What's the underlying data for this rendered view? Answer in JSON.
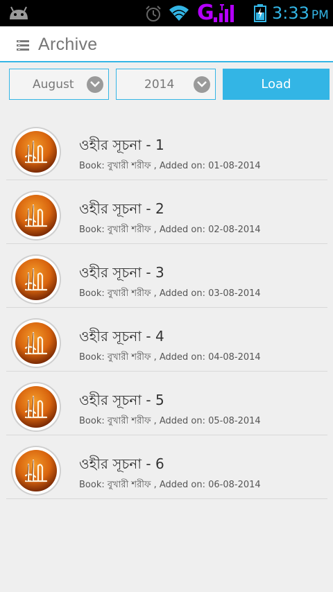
{
  "status_bar": {
    "time": "3:33",
    "ampm": "PM",
    "network": "G",
    "icons": [
      "android-icon",
      "alarm-icon",
      "wifi-icon",
      "signal-icon",
      "battery-icon"
    ],
    "accent_color": "#33b5e5",
    "network_color": "#b400ff"
  },
  "action_bar": {
    "title": "Archive"
  },
  "filters": {
    "month": "August",
    "year": "2014",
    "load_label": "Load"
  },
  "items": [
    {
      "title": "ওহীর সূচনা - 1",
      "meta": "Book: বুখারী শরীফ , Added on: 01-08-2014"
    },
    {
      "title": "ওহীর সূচনা - 2",
      "meta": "Book: বুখারী শরীফ , Added on: 02-08-2014"
    },
    {
      "title": "ওহীর সূচনা - 3",
      "meta": "Book: বুখারী শরীফ , Added on: 03-08-2014"
    },
    {
      "title": "ওহীর সূচনা - 4",
      "meta": "Book: বুখারী শরীফ , Added on: 04-08-2014"
    },
    {
      "title": "ওহীর সূচনা - 5",
      "meta": "Book: বুখারী শরীফ , Added on: 05-08-2014"
    },
    {
      "title": "ওহীর সূচনা - 6",
      "meta": "Book: বুখারী শরীফ , Added on: 06-08-2014"
    }
  ]
}
